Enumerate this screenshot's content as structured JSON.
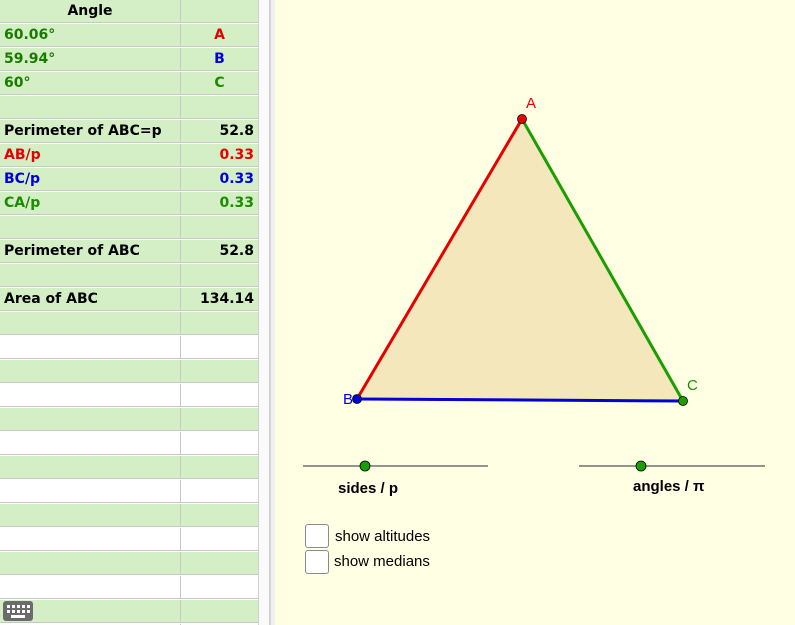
{
  "colors": {
    "red": "#e60000",
    "blue": "#0000d9",
    "green": "#1a8c00",
    "dark_green": "#1a7a00",
    "fill": "#f4e7bc",
    "bg": "#ffffe4"
  },
  "spreadsheet": {
    "rows": [
      {
        "a": "Angle",
        "b": "",
        "a_color": "#000000",
        "b_color": "#000000",
        "a_center": true
      },
      {
        "a": "60.06°",
        "b": "A",
        "a_color": "#1a7a00",
        "b_color": "#e60000",
        "b_center": true
      },
      {
        "a": "59.94°",
        "b": "B",
        "a_color": "#1a7a00",
        "b_color": "#0000d9",
        "b_center": true
      },
      {
        "a": "60°",
        "b": "C",
        "a_color": "#1a7a00",
        "b_color": "#1a8c00",
        "b_center": true
      },
      {
        "a": "",
        "b": ""
      },
      {
        "a": "Perimeter of ABC=p",
        "b": "52.8",
        "a_color": "#000000",
        "b_color": "#000000"
      },
      {
        "a": "AB/p",
        "b": "0.33",
        "a_color": "#e60000",
        "b_color": "#e60000"
      },
      {
        "a": "BC/p",
        "b": "0.33",
        "a_color": "#0000d9",
        "b_color": "#0000d9"
      },
      {
        "a": "CA/p",
        "b": "0.33",
        "a_color": "#1a8c00",
        "b_color": "#1a8c00"
      },
      {
        "a": "",
        "b": ""
      },
      {
        "a": "Perimeter of ABC",
        "b": "52.8",
        "a_color": "#000000",
        "b_color": "#000000"
      },
      {
        "a": "",
        "b": ""
      },
      {
        "a": "Area of ABC",
        "b": "134.14",
        "a_color": "#000000",
        "b_color": "#000000"
      }
    ]
  },
  "graphics": {
    "points": {
      "A": "A",
      "B": "B",
      "C": "C"
    },
    "slider_sides_label": "sides / p",
    "slider_angles_label": "angles / π",
    "checkbox_altitudes_label": "show altitudes",
    "checkbox_medians_label": "show medians",
    "checkbox_altitudes_checked": false,
    "checkbox_medians_checked": false
  },
  "icons": {
    "keyboard": "keyboard-icon"
  }
}
